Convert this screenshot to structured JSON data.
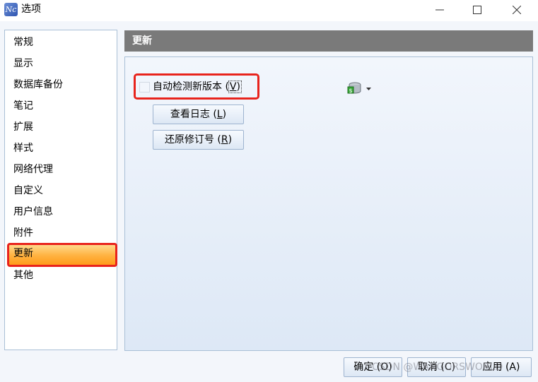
{
  "window": {
    "title": "选项",
    "app_icon_text": "Nc",
    "app_icon": "navicat-icon"
  },
  "sidebar": {
    "items": [
      {
        "label": "常规"
      },
      {
        "label": "显示"
      },
      {
        "label": "数据库备份"
      },
      {
        "label": "笔记"
      },
      {
        "label": "扩展"
      },
      {
        "label": "样式"
      },
      {
        "label": "网络代理"
      },
      {
        "label": "自定义"
      },
      {
        "label": "用户信息"
      },
      {
        "label": "附件"
      },
      {
        "label": "更新",
        "selected": true
      },
      {
        "label": "其他"
      }
    ]
  },
  "section": {
    "title": "更新"
  },
  "update": {
    "auto_check": {
      "label": "自动检测新版本 (",
      "hotkey": "V",
      "suffix": ")",
      "checked": false
    },
    "view_log": {
      "label": "查看日志 (",
      "hotkey": "L",
      "suffix": ")"
    },
    "restore": {
      "label": "还原修订号 (",
      "hotkey": "R",
      "suffix": ")"
    },
    "db_dropdown_icon": "database-icon"
  },
  "footer": {
    "ok": "确定 (O)",
    "cancel": "取消 (C)",
    "apply": "应用 (A)"
  },
  "watermark": "CSDN @WANGORSWORLD",
  "colors": {
    "highlight": "#e8231c",
    "selected_bg": "#ffb13f",
    "header_bg": "#7a7a7a"
  }
}
